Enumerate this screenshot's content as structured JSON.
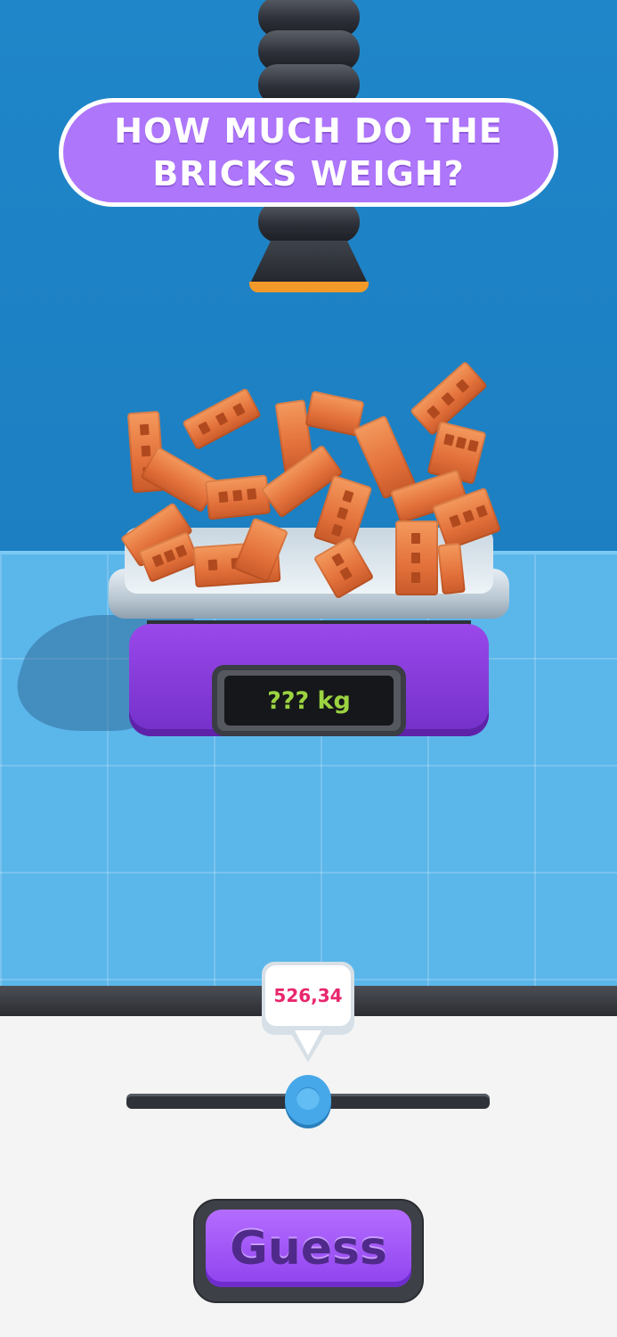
{
  "game": {
    "question": "HOW MUCH DO THE BRICKS WEIGH?",
    "scale_display": "??? kg",
    "slider_value_label": "526,34",
    "slider_position": 0.5,
    "guess_button_label": "Guess"
  },
  "colors": {
    "wall": "#1f86c9",
    "floor": "#5bb6ea",
    "question_bg": "#ae76fb",
    "scale_body": "#8b3fe0",
    "display_text": "#9bd341",
    "slider_value_text": "#e8266d",
    "slider_knob": "#46a8e8",
    "brick": "#e3713b"
  }
}
